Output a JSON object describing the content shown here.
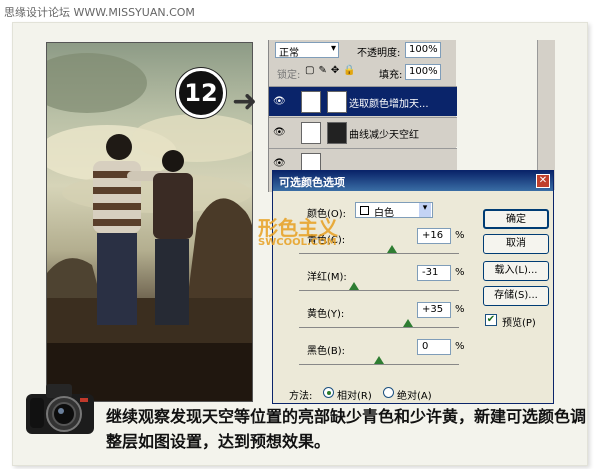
{
  "watermark": {
    "site": "思缘设计论坛  WWW.MISSYUAN.COM",
    "logo_cn": "形色主义",
    "logo_en": "SWCOOL.COM"
  },
  "step": "12",
  "layers_panel": {
    "blend_mode": "正常",
    "opacity_label": "不透明度:",
    "opacity_value": "100%",
    "lock_label": "锁定:",
    "fill_label": "填充:",
    "fill_value": "100%",
    "layers": [
      {
        "name": "选取颜色增加天...",
        "active": true
      },
      {
        "name": "曲线减少天空红",
        "active": false
      },
      {
        "name": "",
        "active": false
      }
    ]
  },
  "dialog": {
    "title": "可选颜色选项",
    "color_label": "颜色(O):",
    "color_value": "白色",
    "sliders": [
      {
        "label": "青色(C):",
        "value": "+16",
        "unit": "%",
        "level": 0.58
      },
      {
        "label": "洋红(M):",
        "value": "-31",
        "unit": "%",
        "level": 0.35
      },
      {
        "label": "黄色(Y):",
        "value": "+35",
        "unit": "%",
        "level": 0.67
      },
      {
        "label": "黑色(B):",
        "value": "0",
        "unit": "%",
        "level": 0.5
      }
    ],
    "buttons": {
      "ok": "确定",
      "cancel": "取消",
      "load": "载入(L)...",
      "save": "存储(S)..."
    },
    "preview_label": "预览(P)",
    "preview_checked": true,
    "method_label": "方法:",
    "method_relative": "相对(R)",
    "method_absolute": "绝对(A)",
    "method_selected": "relative"
  },
  "caption": "继续观察发现天空等位置的亮部缺少青色和少许黄，新建可选颜色调整层如图设置，达到预想效果。"
}
